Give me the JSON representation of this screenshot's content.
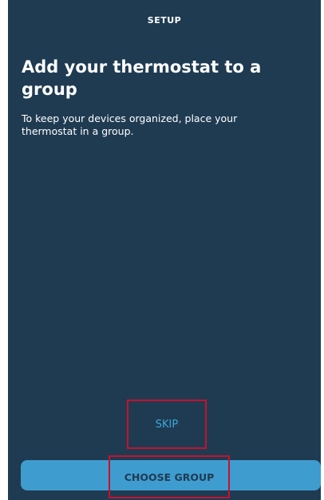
{
  "header": {
    "title": "SETUP"
  },
  "main": {
    "title": "Add your thermostat to a group",
    "description": "To keep your devices organized, place your thermostat in a group."
  },
  "actions": {
    "skip_label": "SKIP",
    "choose_group_label": "CHOOSE GROUP"
  },
  "colors": {
    "background": "#1f3b52",
    "accent": "#3f9ccf",
    "link": "#3aa8dc",
    "highlight_border": "#c8102e"
  }
}
